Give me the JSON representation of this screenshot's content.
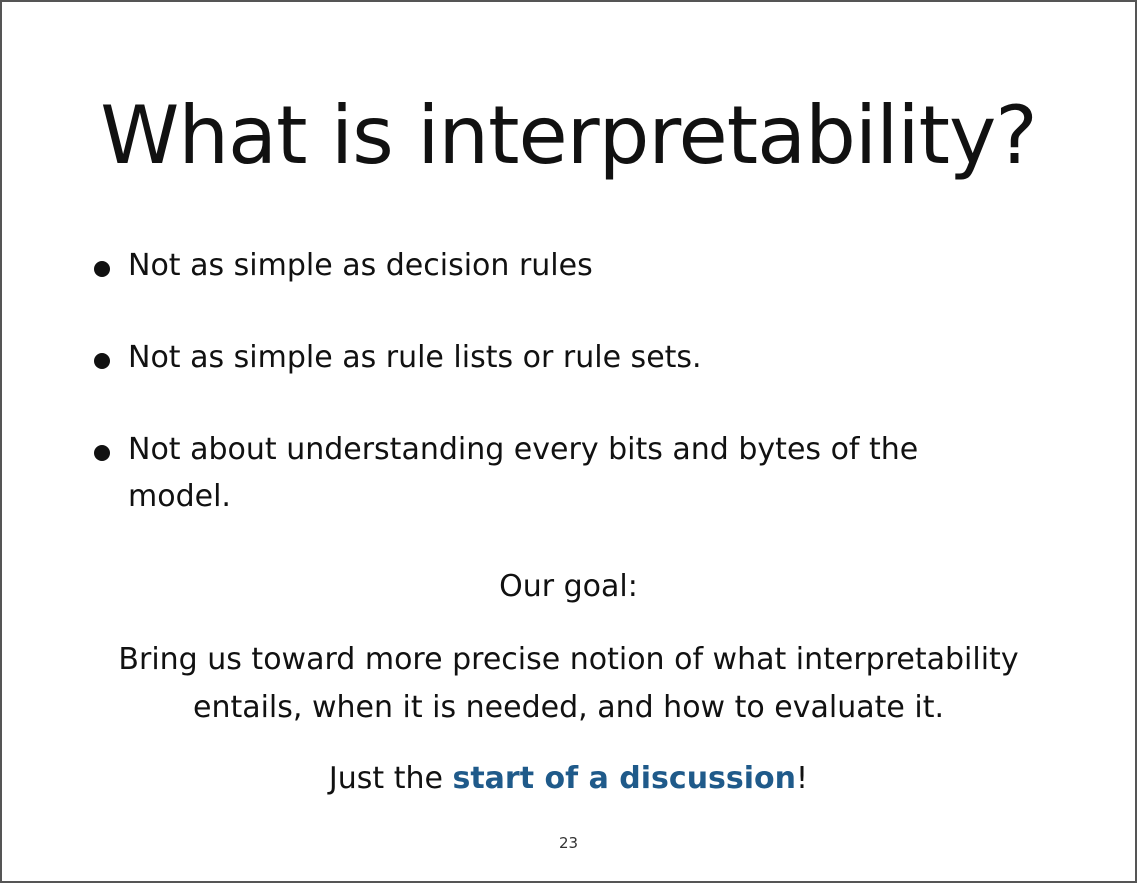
{
  "slide": {
    "title": "What is interpretability?",
    "bullets": [
      {
        "text": "Not as simple as decision rules"
      },
      {
        "text": "Not as simple as rule lists or rule sets."
      },
      {
        "text": "Not about understanding every bits and bytes of the model."
      }
    ],
    "goal_label": "Our goal:",
    "goal_text": "Bring us toward more precise notion of what interpretability entails, when it is needed, and how to evaluate it.",
    "discussion": {
      "prefix": "Just the ",
      "highlight": "start of a discussion",
      "suffix": "!"
    },
    "page_number": "23",
    "highlight_color": "#1f5a8a"
  }
}
